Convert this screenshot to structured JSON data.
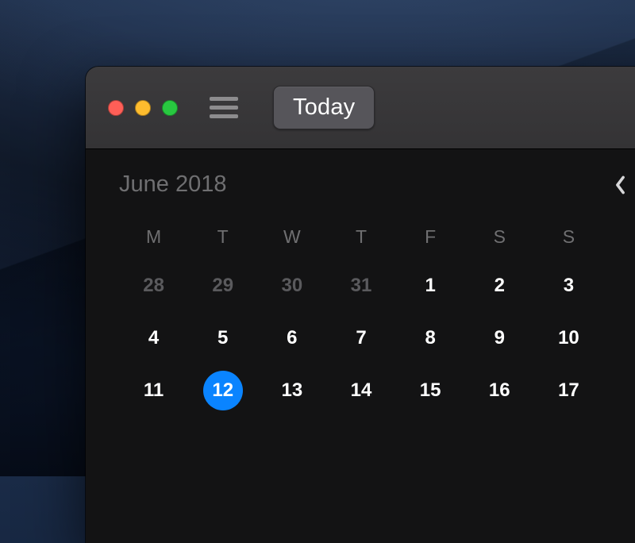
{
  "toolbar": {
    "today_label": "Today"
  },
  "month": {
    "label": "June 2018"
  },
  "weekdays": [
    "M",
    "T",
    "W",
    "T",
    "F",
    "S",
    "S"
  ],
  "weeks": [
    [
      {
        "n": "28",
        "muted": true,
        "selected": false
      },
      {
        "n": "29",
        "muted": true,
        "selected": false
      },
      {
        "n": "30",
        "muted": true,
        "selected": false
      },
      {
        "n": "31",
        "muted": true,
        "selected": false
      },
      {
        "n": "1",
        "muted": false,
        "selected": false
      },
      {
        "n": "2",
        "muted": false,
        "selected": false
      },
      {
        "n": "3",
        "muted": false,
        "selected": false
      }
    ],
    [
      {
        "n": "4",
        "muted": false,
        "selected": false
      },
      {
        "n": "5",
        "muted": false,
        "selected": false
      },
      {
        "n": "6",
        "muted": false,
        "selected": false
      },
      {
        "n": "7",
        "muted": false,
        "selected": false
      },
      {
        "n": "8",
        "muted": false,
        "selected": false
      },
      {
        "n": "9",
        "muted": false,
        "selected": false
      },
      {
        "n": "10",
        "muted": false,
        "selected": false
      }
    ],
    [
      {
        "n": "11",
        "muted": false,
        "selected": false
      },
      {
        "n": "12",
        "muted": false,
        "selected": true
      },
      {
        "n": "13",
        "muted": false,
        "selected": false
      },
      {
        "n": "14",
        "muted": false,
        "selected": false
      },
      {
        "n": "15",
        "muted": false,
        "selected": false
      },
      {
        "n": "16",
        "muted": false,
        "selected": false
      },
      {
        "n": "17",
        "muted": false,
        "selected": false
      }
    ]
  ]
}
